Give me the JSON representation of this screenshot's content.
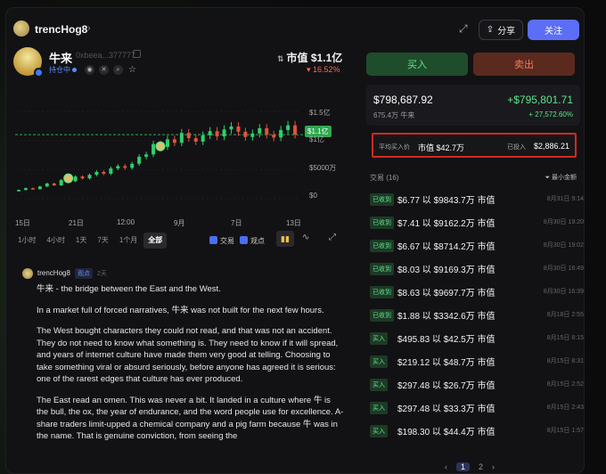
{
  "header": {
    "username": "trencHog8",
    "share_label": "分享",
    "follow_label": "关注"
  },
  "token": {
    "name": "牛来",
    "address": "0xbeea...377777",
    "holding_badge": "持仓中",
    "mcap_label": "市值 $1.1亿",
    "change": "▾ 16.52%"
  },
  "actions": {
    "buy": "买入",
    "sell": "卖出"
  },
  "chart": {
    "price_tag": "$1.1亿"
  },
  "chart_data": {
    "type": "candlestick",
    "y_tick_labels": [
      "$1.5亿",
      "$1亿",
      "$5000万",
      "$0"
    ],
    "x_tick_labels": [
      "15日",
      "21日",
      "12:00",
      "9月",
      "7日",
      "13日"
    ],
    "series": [
      {
        "values": [
          1500,
          1800,
          1650,
          2100,
          2600,
          2300,
          3200,
          3000,
          3800,
          3500,
          4100,
          4600,
          4300,
          5200,
          5600,
          5300,
          6000,
          7200,
          7600,
          9400,
          8900,
          10200,
          9600,
          11300,
          10400,
          9800,
          10900,
          11600,
          10700,
          11900,
          12400,
          11500,
          10600,
          11200,
          12100,
          11000,
          10500,
          11800,
          12600,
          11000
        ]
      }
    ]
  },
  "range": {
    "options": [
      "1小时",
      "4小时",
      "1天",
      "7天",
      "1个月",
      "全部"
    ],
    "active": "全部",
    "trades_label": "交易",
    "views_label": "观点"
  },
  "post": {
    "author": "trencHog8",
    "tag": "观点",
    "time": "2天",
    "paragraphs": [
      "牛来 - the bridge between the East and the West.",
      "In a market full of forced narratives, 牛来 was not built for the next few hours.",
      "The West bought characters they could not read, and that was not an accident. They do not need to know what something is. They need to know if it will spread, and years of internet culture have made them very good at telling. Choosing to take something viral or absurd seriously, before anyone has agreed it is serious: one of the rarest edges that culture has ever produced.",
      "The East read an omen. This was never a bit. It landed in a culture where 牛 is the bull, the ox, the year of endurance, and the word people use for excellence. A-share traders limit-upped a chemical company and a pig farm because 牛 was in the name. That is genuine conviction, from seeing the"
    ]
  },
  "portfolio": {
    "balance": "$798,687.92",
    "amount": "675.4万 牛来",
    "pnl": "+$795,801.71",
    "pnl_pct": "+ 27,572.60%",
    "avg_label": "平均买入价",
    "avg_value": "市值 $42.7万",
    "invested_label": "已投入",
    "invested_value": "$2,886.21"
  },
  "transactions": {
    "header": "交易 (16)",
    "filter": "最小金额",
    "rows": [
      {
        "type": "已收到",
        "text": "$6.77 以 $9843.7万 市值",
        "time": "8月31日 9:14"
      },
      {
        "type": "已收到",
        "text": "$7.41 以 $9162.2万 市值",
        "time": "8月30日 19:20"
      },
      {
        "type": "已收到",
        "text": "$6.67 以 $8714.2万 市值",
        "time": "8月30日 19:02"
      },
      {
        "type": "已收到",
        "text": "$8.03 以 $9169.3万 市值",
        "time": "8月30日 16:49"
      },
      {
        "type": "已收到",
        "text": "$8.63 以 $9697.7万 市值",
        "time": "8月30日 16:39"
      },
      {
        "type": "已收到",
        "text": "$1.88 以 $3342.6万 市值",
        "time": "8月18日 2:55"
      },
      {
        "type": "买入",
        "text": "$495.83 以 $42.5万 市值",
        "time": "8月15日 8:15"
      },
      {
        "type": "买入",
        "text": "$219.12 以 $48.7万 市值",
        "time": "8月15日 8:31"
      },
      {
        "type": "买入",
        "text": "$297.48 以 $26.7万 市值",
        "time": "8月15日 2:52"
      },
      {
        "type": "买入",
        "text": "$297.48 以 $33.3万 市值",
        "time": "8月15日 2:43"
      },
      {
        "type": "买入",
        "text": "$198.30 以 $44.4万 市值",
        "time": "8月15日 1:57"
      }
    ],
    "pages": [
      "1",
      "2"
    ]
  }
}
